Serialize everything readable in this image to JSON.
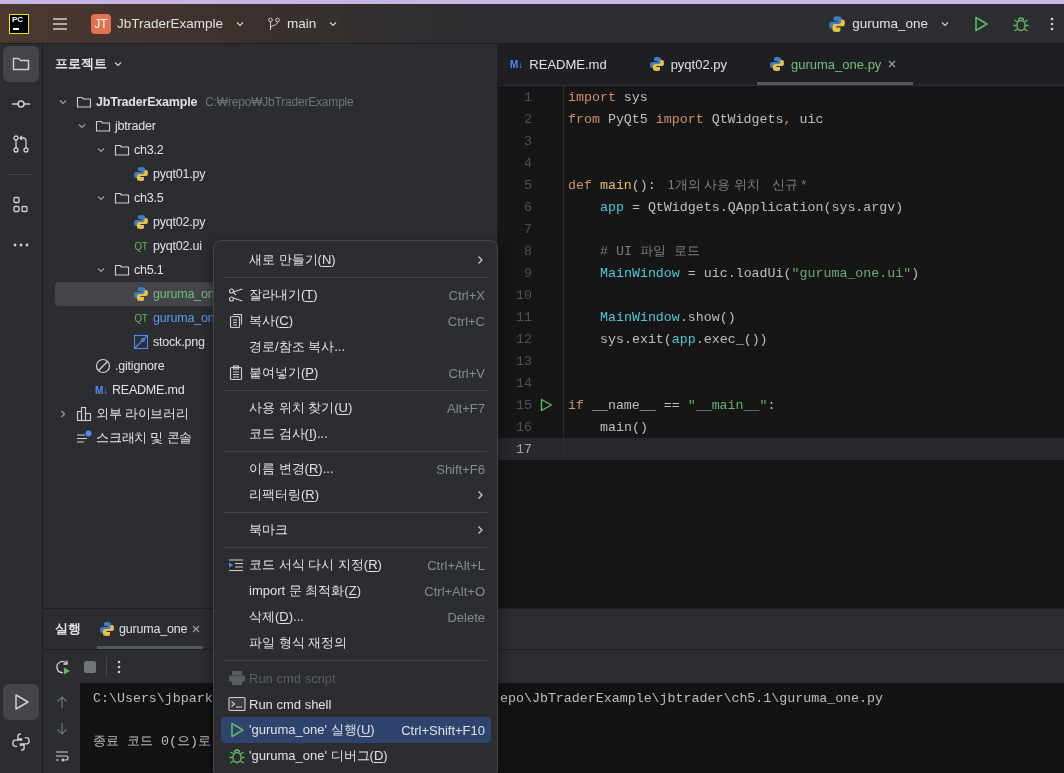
{
  "title_bar": {
    "logo": "PC",
    "project_badge": "JT",
    "project": "JbTraderExample",
    "branch": "main",
    "run_config": "guruma_one"
  },
  "tool_strip": {
    "top_groups": [
      [
        {
          "kind": "folder",
          "selected": true
        },
        {
          "kind": "commit",
          "selected": false
        },
        {
          "kind": "pull",
          "selected": false
        }
      ],
      [
        {
          "kind": "structure",
          "selected": false
        },
        {
          "kind": "more",
          "selected": false
        }
      ]
    ],
    "bottom": [
      {
        "kind": "run",
        "selected": true
      },
      {
        "kind": "python",
        "selected": false
      }
    ]
  },
  "project_panel": {
    "title": "프로젝트",
    "tree": [
      {
        "name": "JbTraderExample",
        "kind": "folder",
        "path": "C:₩repo₩JbTraderExample",
        "expanded": true,
        "selected": false,
        "children": [
          {
            "name": "jbtrader",
            "kind": "folder",
            "expanded": true,
            "selected": false,
            "children": [
              {
                "name": "ch3.2",
                "kind": "folder",
                "expanded": true,
                "selected": false,
                "children": [
                  {
                    "name": "pyqt01.py",
                    "kind": "python",
                    "selected": false
                  }
                ]
              },
              {
                "name": "ch3.5",
                "kind": "folder",
                "expanded": true,
                "selected": false,
                "children": [
                  {
                    "name": "pyqt02.py",
                    "kind": "python",
                    "selected": false
                  },
                  {
                    "name": "pyqt02.ui",
                    "kind": "qt",
                    "icon_text": "QT",
                    "selected": false
                  }
                ]
              },
              {
                "name": "ch5.1",
                "kind": "folder",
                "expanded": true,
                "selected": false,
                "children": [
                  {
                    "name": "guruma_on",
                    "kind": "python",
                    "color": "#73bd79",
                    "selected": true
                  },
                  {
                    "name": "guruma_on",
                    "kind": "qt",
                    "icon_text": "QT",
                    "color": "#5c9bf0",
                    "selected": false
                  },
                  {
                    "name": "stock.png",
                    "kind": "image",
                    "selected": false
                  }
                ]
              }
            ]
          },
          {
            "name": ".gitignore",
            "kind": "ignore",
            "selected": false
          },
          {
            "name": "README.md",
            "kind": "markdown",
            "icon_text": "M↓",
            "selected": false
          }
        ]
      },
      {
        "name": "외부 라이브러리",
        "kind": "library",
        "expanded": false,
        "selected": false
      },
      {
        "name": "스크래치 및 콘솔",
        "kind": "scratch",
        "selected": false
      }
    ]
  },
  "editor": {
    "tabs": [
      {
        "label": "README.md",
        "kind": "markdown",
        "icon_text": "M↓",
        "selected": false
      },
      {
        "label": "pyqt02.py",
        "kind": "python",
        "selected": false
      },
      {
        "label": "guruma_one.py",
        "kind": "python",
        "selected": true
      }
    ],
    "lines": [
      {
        "number": "1",
        "current": false,
        "run": false,
        "indented": false,
        "tokens": [
          {
            "kind": "kw",
            "text": "import"
          },
          {
            "kind": "plain",
            "text": " sys"
          }
        ]
      },
      {
        "number": "2",
        "current": false,
        "run": false,
        "indented": false,
        "tokens": [
          {
            "kind": "kw",
            "text": "from"
          },
          {
            "kind": "plain",
            "text": " PyQt5 "
          },
          {
            "kind": "kw",
            "text": "import"
          },
          {
            "kind": "plain",
            "text": " QtWidgets"
          },
          {
            "kind": "kw",
            "text": ","
          },
          {
            "kind": "plain",
            "text": " uic"
          }
        ]
      },
      {
        "number": "3",
        "current": false,
        "run": false
      },
      {
        "number": "4",
        "current": false,
        "run": false
      },
      {
        "number": "5",
        "current": false,
        "run": false,
        "indented": false,
        "tokens": [
          {
            "kind": "kw",
            "text": "def "
          },
          {
            "kind": "fn",
            "text": "main"
          },
          {
            "kind": "plain",
            "text": "():"
          },
          {
            "kind": "hint",
            "text": "1개의 사용 위치"
          },
          {
            "kind": "hint",
            "text": "신규 *"
          }
        ]
      },
      {
        "number": "6",
        "current": false,
        "run": false,
        "indented": true,
        "tokens": [
          {
            "kind": "local",
            "text": "app"
          },
          {
            "kind": "plain",
            "text": " = QtWidgets.QApplication(sys.argv)"
          }
        ]
      },
      {
        "number": "7",
        "current": false,
        "run": false
      },
      {
        "number": "8",
        "current": false,
        "run": false,
        "indented": true,
        "tokens": [
          {
            "kind": "comment",
            "text": "# UI 파일 로드"
          }
        ]
      },
      {
        "number": "9",
        "current": false,
        "run": false,
        "indented": true,
        "tokens": [
          {
            "kind": "local",
            "text": "MainWindow"
          },
          {
            "kind": "plain",
            "text": " = uic.loadUi("
          },
          {
            "kind": "str",
            "text": "\"guruma_one.ui\""
          },
          {
            "kind": "plain",
            "text": ")"
          }
        ]
      },
      {
        "number": "10",
        "current": false,
        "run": false
      },
      {
        "number": "11",
        "current": false,
        "run": false,
        "indented": true,
        "tokens": [
          {
            "kind": "local",
            "text": "MainWindow"
          },
          {
            "kind": "plain",
            "text": ".show()"
          }
        ]
      },
      {
        "number": "12",
        "current": false,
        "run": false,
        "indented": true,
        "tokens": [
          {
            "kind": "plain",
            "text": "sys.exit("
          },
          {
            "kind": "local",
            "text": "app"
          },
          {
            "kind": "plain",
            "text": ".exec_())"
          }
        ]
      },
      {
        "number": "13",
        "current": false,
        "run": false
      },
      {
        "number": "14",
        "current": false,
        "run": false
      },
      {
        "number": "15",
        "current": false,
        "run": true,
        "indented": false,
        "tokens": [
          {
            "kind": "kw",
            "text": "if"
          },
          {
            "kind": "plain",
            "text": " __name__ == "
          },
          {
            "kind": "str",
            "text": "\"__main__\""
          },
          {
            "kind": "plain",
            "text": ":"
          }
        ]
      },
      {
        "number": "16",
        "current": false,
        "run": false,
        "indented": true,
        "tokens": [
          {
            "kind": "plain",
            "text": "main()"
          }
        ]
      },
      {
        "number": "17",
        "current": true,
        "run": false
      }
    ]
  },
  "run_panel": {
    "title": "실행",
    "tab": {
      "label": "guruma_one",
      "selected": true
    },
    "console": [
      {
        "start": "C:\\Users\\jbpark",
        "end": "epo\\JbTraderExample\\jbtrader\\ch5.1\\guruma_one.py"
      },
      {
        "start": "종료 코드 0(으)로"
      }
    ]
  },
  "context_menu": {
    "groups": [
      [
        {
          "kind": "plain",
          "text": "새로 만들기(",
          "mnemonic": "N",
          "after": ")",
          "submenu": true,
          "disabled": false,
          "selected": false
        }
      ],
      [
        {
          "kind": "cut",
          "text": "잘라내기(",
          "mnemonic": "T",
          "after": ")",
          "shortcut": "Ctrl+X",
          "disabled": false,
          "selected": false
        },
        {
          "kind": "copy",
          "text": "복사(",
          "mnemonic": "C",
          "after": ")",
          "shortcut": "Ctrl+C",
          "disabled": false,
          "selected": false
        },
        {
          "kind": "plain",
          "text": "경로/참조 복사...",
          "disabled": false,
          "selected": false
        },
        {
          "kind": "paste",
          "text": "붙여넣기(",
          "mnemonic": "P",
          "after": ")",
          "shortcut": "Ctrl+V",
          "disabled": false,
          "selected": false
        }
      ],
      [
        {
          "kind": "plain",
          "text": "사용 위치 찾기(",
          "mnemonic": "U",
          "after": ")",
          "shortcut": "Alt+F7",
          "disabled": false,
          "selected": false
        },
        {
          "kind": "plain",
          "text": "코드 검사(",
          "mnemonic": "I",
          "after": ")...",
          "disabled": false,
          "selected": false
        }
      ],
      [
        {
          "kind": "plain",
          "text": "이름 변경(",
          "mnemonic": "R",
          "after": ")...",
          "shortcut": "Shift+F6",
          "disabled": false,
          "selected": false
        },
        {
          "kind": "plain",
          "text": "리팩터링(",
          "mnemonic": "R",
          "after": ")",
          "submenu": true,
          "disabled": false,
          "selected": false
        }
      ],
      [
        {
          "kind": "plain",
          "text": "북마크",
          "submenu": true,
          "disabled": false,
          "selected": false
        }
      ],
      [
        {
          "kind": "reformat",
          "text": "코드 서식 다시 지정(",
          "mnemonic": "R",
          "after": ")",
          "shortcut": "Ctrl+Alt+L",
          "disabled": false,
          "selected": false
        },
        {
          "kind": "plain",
          "text": "import 문 최적화(",
          "mnemonic": "Z",
          "after": ")",
          "shortcut": "Ctrl+Alt+O",
          "disabled": false,
          "selected": false
        },
        {
          "kind": "plain",
          "text": "삭제(",
          "mnemonic": "D",
          "after": ")...",
          "shortcut": "Delete",
          "disabled": false,
          "selected": false
        },
        {
          "kind": "plain",
          "text": "파일 형식 재정의",
          "disabled": false,
          "selected": false
        }
      ],
      [
        {
          "kind": "script",
          "text": "Run cmd script",
          "disabled": true,
          "selected": false
        },
        {
          "kind": "shell",
          "text": "Run cmd shell",
          "disabled": false,
          "selected": false
        },
        {
          "kind": "run",
          "text": "'guruma_one' 실행(",
          "mnemonic": "U",
          "after": ")",
          "shortcut": "Ctrl+Shift+F10",
          "disabled": false,
          "selected": true
        },
        {
          "kind": "debug",
          "text": "'guruma_one' 디버그(",
          "mnemonic": "D",
          "after": ")",
          "disabled": false,
          "selected": false
        }
      ]
    ]
  }
}
